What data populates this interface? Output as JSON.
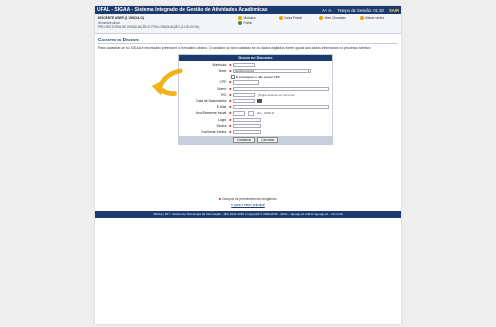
{
  "header": {
    "system_title": "UFAL - SIGAA - Sistema Integrado de Gestão de Atividades Acadêmicas",
    "help": "A+ A-",
    "time": "Tempo de Sessão: 01:30",
    "logout": "SAIR"
  },
  "user": {
    "name": "DISCENTE USER (1 VÍNCULO)",
    "sub1": "Semestre atual",
    "sub2": "PRO-REITORIA DE GRADUAÇÃO E PÓS-GRADUAÇÃO (11.00.00.00)"
  },
  "menu": [
    {
      "label": "Módulos",
      "color": "#e8a400"
    },
    {
      "label": "Caixa Postal",
      "color": "#e8a400"
    },
    {
      "label": "Abrir Chamado",
      "color": "#e8a400"
    },
    {
      "label": "Alterar senha",
      "color": "#e8a400"
    },
    {
      "label": "Portal",
      "color": "#3a8f3a"
    }
  ],
  "section_title": "Cadastro de Discente",
  "instructions": "Para cadastrar-se no SIGAA é necessário preencher o formulário abaixo. O cadastro só será validado se os dados digitados forem iguais aos dados informados no processo seletivo.",
  "form": {
    "caption": "Dados do Discente",
    "labels": {
      "matricula": "Matrícula:",
      "nivel": "Nível:",
      "cpf": "CPF:",
      "nome": "Nome:",
      "rg": "RG:",
      "nascimento": "Data de Nascimento:",
      "email": "E-Mail:",
      "ano_periodo": "Ano/Semestre Inicial:",
      "login": "Login:",
      "senha": "Senha:",
      "confirmar": "Confirmar Senha:"
    },
    "nivel_value": "GRADUAÇÃO",
    "foreigner_label": "É estrangeiro e não possui CPF",
    "rg_hint": "(Digite apenas os números)",
    "period_hint": "(Ex.: 2008-2)",
    "submit": "Cadastrar",
    "cancel": "Cancelar"
  },
  "required_note": "Campos de preenchimento obrigatório.",
  "back_link": "Ir para o menu principal",
  "footer": "SIGAA | NTI - Núcleo de Tecnologia da Informação - (82) 3214-1015 | Copyright © 2006-2016 - UFAL - sig-app-p1.ufal.br.sig-app-p1 - v3.12.40",
  "colors": {
    "primary": "#1b3a6e",
    "arrow": "#f2b21b"
  }
}
